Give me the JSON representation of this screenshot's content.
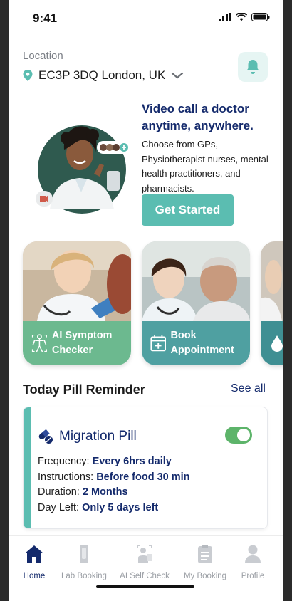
{
  "status_bar": {
    "time": "9:41"
  },
  "location": {
    "label": "Location",
    "value": "EC3P 3DQ London, UK"
  },
  "hero": {
    "title": "Video call a doctor anytime, anywhere.",
    "description": "Choose from GPs, Physiotherapist nurses, mental health practitioners, and pharmacists.",
    "cta_label": "Get Started"
  },
  "services": [
    {
      "label": "AI Symptom Checker",
      "color": "#6cb98f",
      "icon": "body-scan-icon"
    },
    {
      "label": "Book Appointment",
      "color": "#4fa0a1",
      "icon": "calendar-plus-icon"
    },
    {
      "label": "",
      "color": "#3f8f93",
      "icon": "drop-icon"
    }
  ],
  "reminder_section": {
    "title": "Today Pill Reminder",
    "see_all": "See all"
  },
  "pill": {
    "name": "Migration Pill",
    "enabled": true,
    "frequency_label": "Frequency:",
    "frequency_value": "Every 6hrs daily",
    "instructions_label": "Instructions:",
    "instructions_value": "Before food 30 min",
    "duration_label": "Duration:",
    "duration_value": "2 Months",
    "day_left_label": "Day Left:",
    "day_left_value": "Only 5 days left"
  },
  "tabs": [
    {
      "label": "Home",
      "icon": "home-icon",
      "active": true
    },
    {
      "label": "Lab Booking",
      "icon": "test-tube-icon",
      "active": false
    },
    {
      "label": "AI Self Check",
      "icon": "self-check-icon",
      "active": false
    },
    {
      "label": "My Booking",
      "icon": "clipboard-icon",
      "active": false
    },
    {
      "label": "Profile",
      "icon": "profile-icon",
      "active": false
    }
  ],
  "colors": {
    "brand_navy": "#142a6c",
    "accent_teal": "#5bbdb1",
    "toggle_green": "#5db46a"
  }
}
